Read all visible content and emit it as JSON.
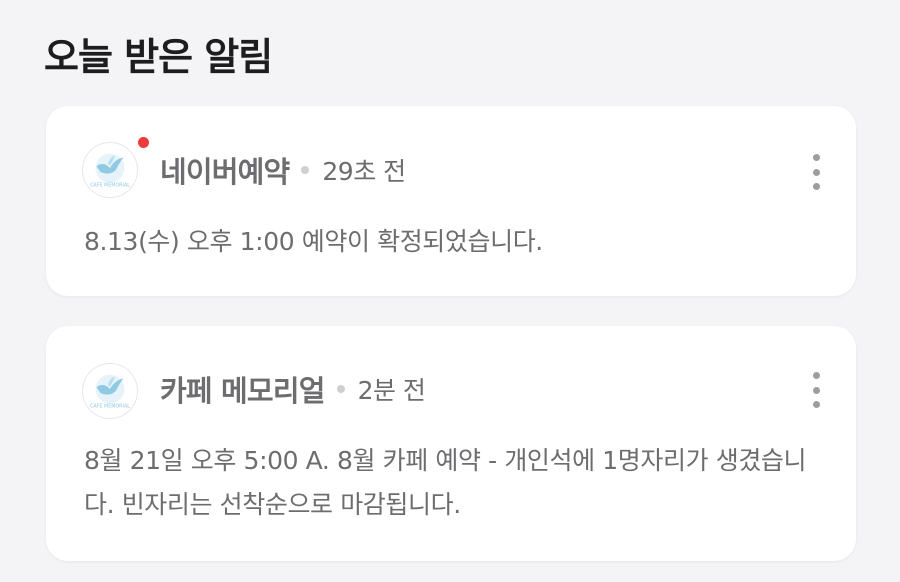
{
  "section": {
    "title": "오늘 받은 알림"
  },
  "notifications": [
    {
      "sender": "네이버예약",
      "time": "29초 전",
      "message": "8.13(수) 오후 1:00 예약이 확정되었습니다.",
      "unread": true,
      "avatar_logo": "CAFE MEMORIAL",
      "avatar_icon": "bird-logo-icon"
    },
    {
      "sender": "카페 메모리얼",
      "time": "2분 전",
      "message": "8월 21일 오후 5:00 A. 8월 카페 예약 - 개인석에 1명자리가 생겼습니다. 빈자리는 선착순으로 마감됩니다.",
      "unread": false,
      "avatar_logo": "CAFE MEMORIAL",
      "avatar_icon": "bird-logo-icon"
    }
  ],
  "colors": {
    "background": "#f4f4f6",
    "card": "#ffffff",
    "title_text": "#1d1d1f",
    "body_text": "#6d6d6f",
    "unread_dot": "#ee3a3a",
    "logo_blue": "#8fc9e2"
  }
}
